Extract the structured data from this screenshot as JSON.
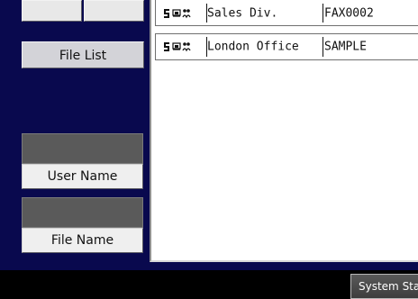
{
  "left_panel": {
    "file_list_label": "File List",
    "user_name_label": "User Name",
    "file_name_label": "File Name"
  },
  "entries": [
    {
      "name": "Sales Div.",
      "code": "FAX0002",
      "icons": [
        "transfer-icon",
        "print-icon",
        "people-icon"
      ]
    },
    {
      "name": "London Office",
      "code": "SAMPLE",
      "icons": [
        "transfer-icon",
        "print-icon",
        "people-icon"
      ]
    }
  ],
  "footer": {
    "system_status_label": "System Status"
  }
}
